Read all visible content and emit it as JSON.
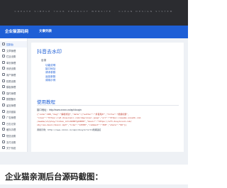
{
  "banner": {
    "text": "CREATE SIMPLE YOUR PRODUCT WEBSITE · CLEAN DESIGN SYSTEM"
  },
  "app": {
    "brand": "企业猫源码网",
    "tab_docs": "文章列表"
  },
  "sidebar": {
    "items": [
      {
        "label": "控制台",
        "icon": "home-icon"
      },
      {
        "label": "文章管理",
        "icon": "document-icon"
      },
      {
        "label": "栏目设置",
        "icon": "folder-icon"
      },
      {
        "label": "单页管理",
        "icon": "page-icon"
      },
      {
        "label": "系统设置",
        "icon": "gear-icon"
      },
      {
        "label": "用户管理",
        "icon": "user-icon"
      },
      {
        "label": "权限设置",
        "icon": "lock-icon"
      },
      {
        "label": "模板管理",
        "icon": "template-icon"
      },
      {
        "label": "插件管理",
        "icon": "plugin-icon"
      },
      {
        "label": "数据备份",
        "icon": "database-icon"
      },
      {
        "label": "留言管理",
        "icon": "message-icon"
      },
      {
        "label": "友情链接",
        "icon": "link-icon"
      },
      {
        "label": "广告管理",
        "icon": "ad-icon"
      },
      {
        "label": "日志记录",
        "icon": "log-icon"
      },
      {
        "label": "缓存清理",
        "icon": "trash-icon"
      },
      {
        "label": "短信设置",
        "icon": "sms-icon"
      },
      {
        "label": "支付设置",
        "icon": "pay-icon"
      },
      {
        "label": "关于系统",
        "icon": "info-icon"
      }
    ]
  },
  "content": {
    "title": "抖音去水印",
    "toc_head": "目录",
    "toc": [
      "功能说明",
      "接口地址",
      "请求参数",
      "返回参数",
      "调用示例"
    ],
    "section_title": "使用教程",
    "api_label": "接口地址：http://www.xxxxx.cn/api/douyin",
    "code_lines": [
      "{\"code\":200,\"msg\":\"解析成功\",\"data\":{\"author\":\"抖音用户\",\"title\":\"视频标题\",",
      "\"cover\":\"https://p3.douyinpic.com/img/cover.jpeg\",\"url\":\"https://aweme.snssdk.com",
      "/aweme/v1/play/?video_id=v0200fg10000\",\"music\":\"https://sf3.douyinvod.com/",
      "obj/ies-music/music.mp3\",\"like\":\"12580\",\"comment\":\"368\",\"share\":\"96\"}}"
    ],
    "code_footer": "调用示例：http://www.xxxxx.cn/api/douyin?url=视频链接"
  },
  "headline": "企业猫亲测后台源码截图：",
  "colors": {
    "primary": "#1e5fd6",
    "banner_bg": "#2b2c30",
    "page_bg": "#eef1f5",
    "code_red": "#c0392b"
  }
}
